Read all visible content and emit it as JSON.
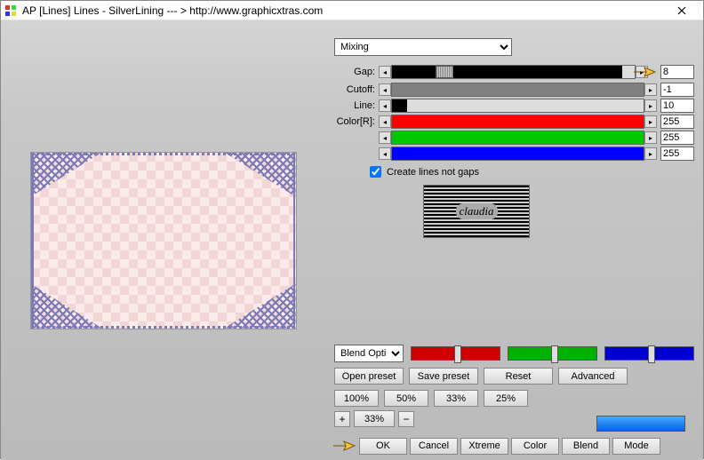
{
  "window": {
    "title": "AP [Lines]  Lines - SilverLining    --- >  http://www.graphicxtras.com"
  },
  "dropdown": {
    "selected": "Mixing"
  },
  "sliders": {
    "gap": {
      "label": "Gap:",
      "value": "8",
      "fill": "#000000",
      "fillPct": 95
    },
    "cutoff": {
      "label": "Cutoff:",
      "value": "-1",
      "fill": "#808080",
      "fillPct": 100
    },
    "line": {
      "label": "Line:",
      "value": "10",
      "fill": "#000000",
      "fillPct": 6
    },
    "r": {
      "label": "Color[R]:",
      "value": "255",
      "fill": "#ff0000",
      "fillPct": 100
    },
    "g": {
      "label": "",
      "value": "255",
      "fill": "#00c800",
      "fillPct": 100
    },
    "b": {
      "label": "",
      "value": "255",
      "fill": "#0000ff",
      "fillPct": 100
    }
  },
  "checkbox": {
    "label": "Create lines not gaps",
    "checked": true
  },
  "logo": "claudia",
  "blendOptions": {
    "label": "Blend Optio"
  },
  "rgb": {
    "r": "#d00000",
    "g": "#00b000",
    "b": "#0000d0"
  },
  "presetButtons": {
    "open": "Open preset",
    "save": "Save preset",
    "reset": "Reset",
    "advanced": "Advanced"
  },
  "pctButtons": {
    "p100": "100%",
    "p50": "50%",
    "p33": "33%",
    "p25": "25%"
  },
  "zoom": {
    "value": "33%"
  },
  "bottom": {
    "ok": "OK",
    "cancel": "Cancel",
    "xtreme": "Xtreme",
    "color": "Color",
    "blend": "Blend",
    "mode": "Mode"
  }
}
